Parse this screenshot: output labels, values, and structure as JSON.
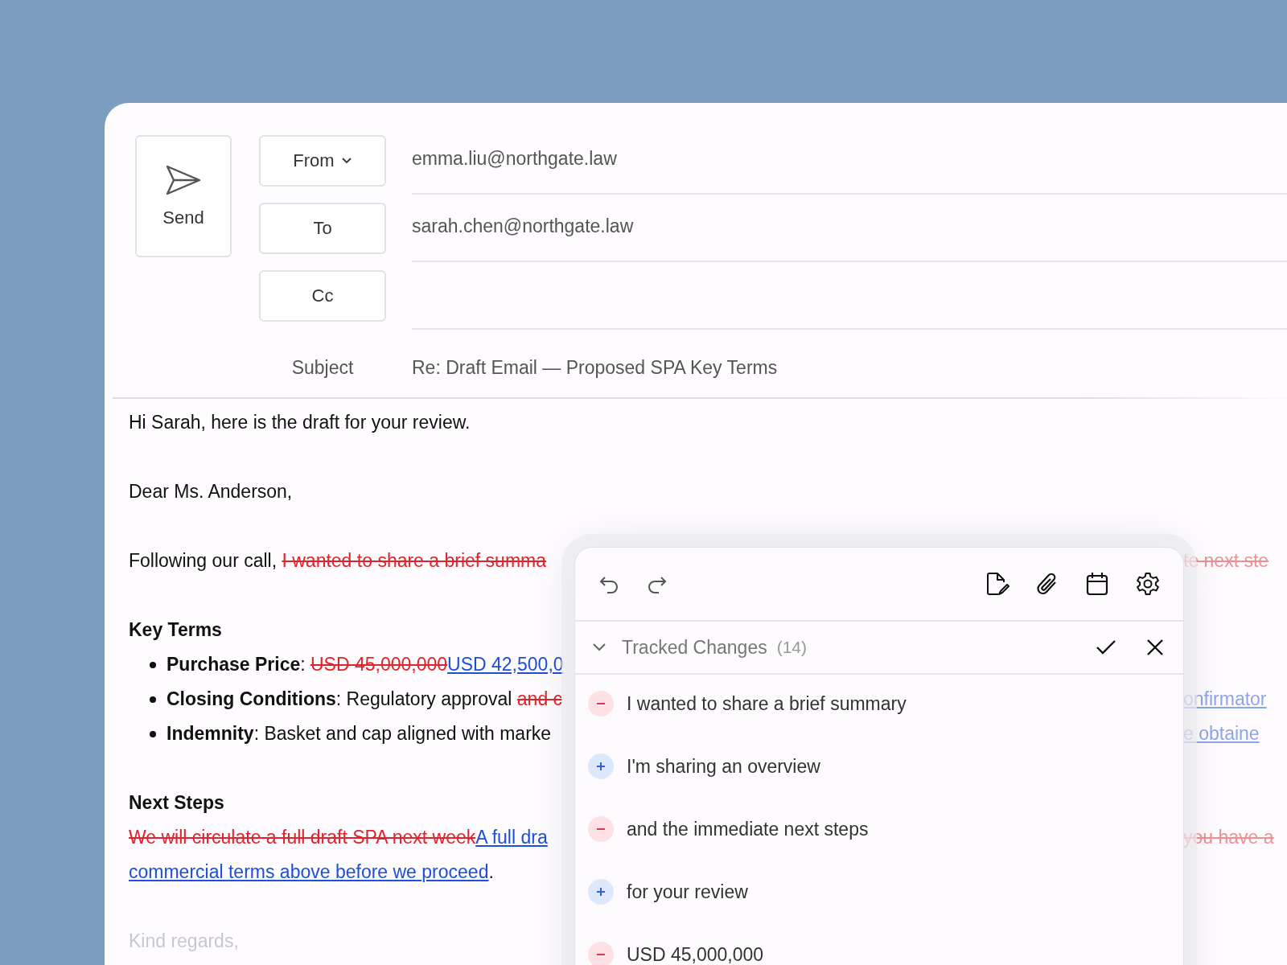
{
  "compose": {
    "send": "Send",
    "from": {
      "label": "From",
      "value": "emma.liu@northgate.law"
    },
    "to": {
      "label": "To",
      "value": "sarah.chen@northgate.law"
    },
    "cc": {
      "label": "Cc"
    },
    "subject": {
      "label": "Subject",
      "value": "Re: Draft Email — Proposed SPA Key Terms"
    }
  },
  "body": [
    {
      "kind": "para",
      "segments": [
        {
          "kind": "plain",
          "text": "Hi Sarah, here is the draft for your review."
        }
      ]
    },
    {
      "kind": "para",
      "segments": [
        {
          "kind": "plain",
          "text": "Dear Ms. Anderson,"
        }
      ]
    },
    {
      "kind": "para",
      "segments": [
        {
          "kind": "plain",
          "text": "Following our call, "
        },
        {
          "kind": "deleted",
          "text": "I wanted to share a brief summa"
        }
      ],
      "right": {
        "kind": "deleted",
        "text": "te next ste"
      }
    },
    {
      "kind": "heading",
      "segments": [
        {
          "kind": "bold",
          "text": "Key Terms"
        }
      ]
    },
    {
      "kind": "bullet",
      "segments": [
        {
          "kind": "bold",
          "text": "Purchase Price"
        },
        {
          "kind": "plain",
          "text": ": "
        },
        {
          "kind": "deleted",
          "text": "USD 45,000,000"
        },
        {
          "kind": "inserted",
          "text": "USD 42,500,0"
        }
      ]
    },
    {
      "kind": "bullet",
      "segments": [
        {
          "kind": "bold",
          "text": "Closing Conditions"
        },
        {
          "kind": "plain",
          "text": ": Regulatory approval "
        },
        {
          "kind": "deleted",
          "text": "and c"
        }
      ],
      "right": {
        "kind": "inserted",
        "text": "onfirmator"
      }
    },
    {
      "kind": "bullet",
      "segments": [
        {
          "kind": "bold",
          "text": "Indemnity"
        },
        {
          "kind": "plain",
          "text": ": Basket and cap aligned with marke"
        }
      ],
      "right": {
        "kind": "inserted",
        "text": "e obtaine"
      }
    },
    {
      "kind": "heading",
      "segments": [
        {
          "kind": "bold",
          "text": "Next Steps"
        }
      ]
    },
    {
      "kind": "line",
      "segments": [
        {
          "kind": "deleted",
          "text": "We will circulate a full draft SPA next week"
        },
        {
          "kind": "inserted",
          "text": "A full dra"
        }
      ],
      "right": {
        "kind": "deleted",
        "text": "you have a"
      }
    },
    {
      "kind": "cont",
      "segments": [
        {
          "kind": "inserted",
          "text": "commercial terms above before we proceed"
        },
        {
          "kind": "plain",
          "text": "."
        }
      ]
    },
    {
      "kind": "closing",
      "segments": [
        {
          "kind": "plain",
          "text": "Kind regards,"
        }
      ]
    }
  ],
  "panel": {
    "title": "Tracked Changes",
    "count": "(14)",
    "changes": [
      {
        "kind": "deletion",
        "text": "I wanted to share a brief summary"
      },
      {
        "kind": "insertion",
        "text": "I'm sharing an overview"
      },
      {
        "kind": "deletion",
        "text": "and the immediate next steps"
      },
      {
        "kind": "insertion",
        "text": "for your review"
      },
      {
        "kind": "deletion",
        "text": "USD 45,000,000"
      }
    ]
  }
}
